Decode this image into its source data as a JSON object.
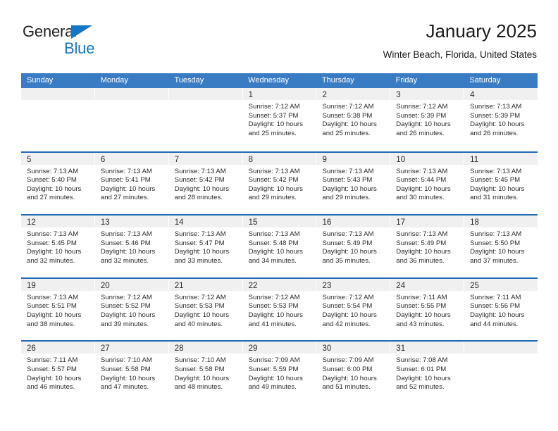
{
  "brand": {
    "name_top": "General",
    "name_bottom": "Blue",
    "triangle_icon": "triangle-icon",
    "accent_color": "#1476c6"
  },
  "header": {
    "title": "January 2025",
    "subtitle": "Winter Beach, Florida, United States"
  },
  "theme": {
    "header_blue": "#3a7cc4",
    "rule_blue": "#1f6ab4",
    "daynum_band": "#f0f0f0",
    "text": "#2b2b2b"
  },
  "weekdays": [
    "Sunday",
    "Monday",
    "Tuesday",
    "Wednesday",
    "Thursday",
    "Friday",
    "Saturday"
  ],
  "weeks": [
    [
      {
        "day": "",
        "lines": []
      },
      {
        "day": "",
        "lines": []
      },
      {
        "day": "",
        "lines": []
      },
      {
        "day": "1",
        "lines": [
          "Sunrise: 7:12 AM",
          "Sunset: 5:37 PM",
          "Daylight: 10 hours",
          "and 25 minutes."
        ]
      },
      {
        "day": "2",
        "lines": [
          "Sunrise: 7:12 AM",
          "Sunset: 5:38 PM",
          "Daylight: 10 hours",
          "and 25 minutes."
        ]
      },
      {
        "day": "3",
        "lines": [
          "Sunrise: 7:12 AM",
          "Sunset: 5:39 PM",
          "Daylight: 10 hours",
          "and 26 minutes."
        ]
      },
      {
        "day": "4",
        "lines": [
          "Sunrise: 7:13 AM",
          "Sunset: 5:39 PM",
          "Daylight: 10 hours",
          "and 26 minutes."
        ]
      }
    ],
    [
      {
        "day": "5",
        "lines": [
          "Sunrise: 7:13 AM",
          "Sunset: 5:40 PM",
          "Daylight: 10 hours",
          "and 27 minutes."
        ]
      },
      {
        "day": "6",
        "lines": [
          "Sunrise: 7:13 AM",
          "Sunset: 5:41 PM",
          "Daylight: 10 hours",
          "and 27 minutes."
        ]
      },
      {
        "day": "7",
        "lines": [
          "Sunrise: 7:13 AM",
          "Sunset: 5:42 PM",
          "Daylight: 10 hours",
          "and 28 minutes."
        ]
      },
      {
        "day": "8",
        "lines": [
          "Sunrise: 7:13 AM",
          "Sunset: 5:42 PM",
          "Daylight: 10 hours",
          "and 29 minutes."
        ]
      },
      {
        "day": "9",
        "lines": [
          "Sunrise: 7:13 AM",
          "Sunset: 5:43 PM",
          "Daylight: 10 hours",
          "and 29 minutes."
        ]
      },
      {
        "day": "10",
        "lines": [
          "Sunrise: 7:13 AM",
          "Sunset: 5:44 PM",
          "Daylight: 10 hours",
          "and 30 minutes."
        ]
      },
      {
        "day": "11",
        "lines": [
          "Sunrise: 7:13 AM",
          "Sunset: 5:45 PM",
          "Daylight: 10 hours",
          "and 31 minutes."
        ]
      }
    ],
    [
      {
        "day": "12",
        "lines": [
          "Sunrise: 7:13 AM",
          "Sunset: 5:45 PM",
          "Daylight: 10 hours",
          "and 32 minutes."
        ]
      },
      {
        "day": "13",
        "lines": [
          "Sunrise: 7:13 AM",
          "Sunset: 5:46 PM",
          "Daylight: 10 hours",
          "and 32 minutes."
        ]
      },
      {
        "day": "14",
        "lines": [
          "Sunrise: 7:13 AM",
          "Sunset: 5:47 PM",
          "Daylight: 10 hours",
          "and 33 minutes."
        ]
      },
      {
        "day": "15",
        "lines": [
          "Sunrise: 7:13 AM",
          "Sunset: 5:48 PM",
          "Daylight: 10 hours",
          "and 34 minutes."
        ]
      },
      {
        "day": "16",
        "lines": [
          "Sunrise: 7:13 AM",
          "Sunset: 5:49 PM",
          "Daylight: 10 hours",
          "and 35 minutes."
        ]
      },
      {
        "day": "17",
        "lines": [
          "Sunrise: 7:13 AM",
          "Sunset: 5:49 PM",
          "Daylight: 10 hours",
          "and 36 minutes."
        ]
      },
      {
        "day": "18",
        "lines": [
          "Sunrise: 7:13 AM",
          "Sunset: 5:50 PM",
          "Daylight: 10 hours",
          "and 37 minutes."
        ]
      }
    ],
    [
      {
        "day": "19",
        "lines": [
          "Sunrise: 7:13 AM",
          "Sunset: 5:51 PM",
          "Daylight: 10 hours",
          "and 38 minutes."
        ]
      },
      {
        "day": "20",
        "lines": [
          "Sunrise: 7:12 AM",
          "Sunset: 5:52 PM",
          "Daylight: 10 hours",
          "and 39 minutes."
        ]
      },
      {
        "day": "21",
        "lines": [
          "Sunrise: 7:12 AM",
          "Sunset: 5:53 PM",
          "Daylight: 10 hours",
          "and 40 minutes."
        ]
      },
      {
        "day": "22",
        "lines": [
          "Sunrise: 7:12 AM",
          "Sunset: 5:53 PM",
          "Daylight: 10 hours",
          "and 41 minutes."
        ]
      },
      {
        "day": "23",
        "lines": [
          "Sunrise: 7:12 AM",
          "Sunset: 5:54 PM",
          "Daylight: 10 hours",
          "and 42 minutes."
        ]
      },
      {
        "day": "24",
        "lines": [
          "Sunrise: 7:11 AM",
          "Sunset: 5:55 PM",
          "Daylight: 10 hours",
          "and 43 minutes."
        ]
      },
      {
        "day": "25",
        "lines": [
          "Sunrise: 7:11 AM",
          "Sunset: 5:56 PM",
          "Daylight: 10 hours",
          "and 44 minutes."
        ]
      }
    ],
    [
      {
        "day": "26",
        "lines": [
          "Sunrise: 7:11 AM",
          "Sunset: 5:57 PM",
          "Daylight: 10 hours",
          "and 46 minutes."
        ]
      },
      {
        "day": "27",
        "lines": [
          "Sunrise: 7:10 AM",
          "Sunset: 5:58 PM",
          "Daylight: 10 hours",
          "and 47 minutes."
        ]
      },
      {
        "day": "28",
        "lines": [
          "Sunrise: 7:10 AM",
          "Sunset: 5:58 PM",
          "Daylight: 10 hours",
          "and 48 minutes."
        ]
      },
      {
        "day": "29",
        "lines": [
          "Sunrise: 7:09 AM",
          "Sunset: 5:59 PM",
          "Daylight: 10 hours",
          "and 49 minutes."
        ]
      },
      {
        "day": "30",
        "lines": [
          "Sunrise: 7:09 AM",
          "Sunset: 6:00 PM",
          "Daylight: 10 hours",
          "and 51 minutes."
        ]
      },
      {
        "day": "31",
        "lines": [
          "Sunrise: 7:08 AM",
          "Sunset: 6:01 PM",
          "Daylight: 10 hours",
          "and 52 minutes."
        ]
      },
      {
        "day": "",
        "lines": []
      }
    ]
  ]
}
